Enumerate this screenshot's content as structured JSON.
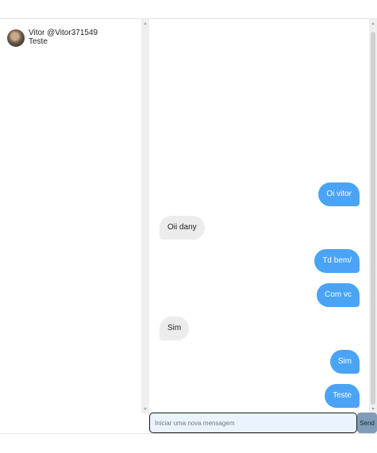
{
  "sidebar": {
    "contacts": [
      {
        "name": "Vitor @Vitor371549",
        "last_message": "Teste",
        "avatar": "user-photo"
      }
    ]
  },
  "chat": {
    "messages": [
      {
        "direction": "sent",
        "text": "Oi vitor"
      },
      {
        "direction": "received",
        "text": "Oii dany"
      },
      {
        "direction": "sent",
        "text": "Td bem/"
      },
      {
        "direction": "sent",
        "text": "Com vc"
      },
      {
        "direction": "received",
        "text": "Sim"
      },
      {
        "direction": "sent",
        "text": "Sim"
      },
      {
        "direction": "sent",
        "text": "Teste"
      }
    ]
  },
  "composer": {
    "placeholder": "Iniciar uma nova mensagem",
    "value": "",
    "send_label": "Send"
  },
  "colors": {
    "sent_bubble": "#4aa3f5",
    "received_bubble": "#ececec",
    "input_bg": "#eaf3ff",
    "send_button": "#7f9db8"
  }
}
